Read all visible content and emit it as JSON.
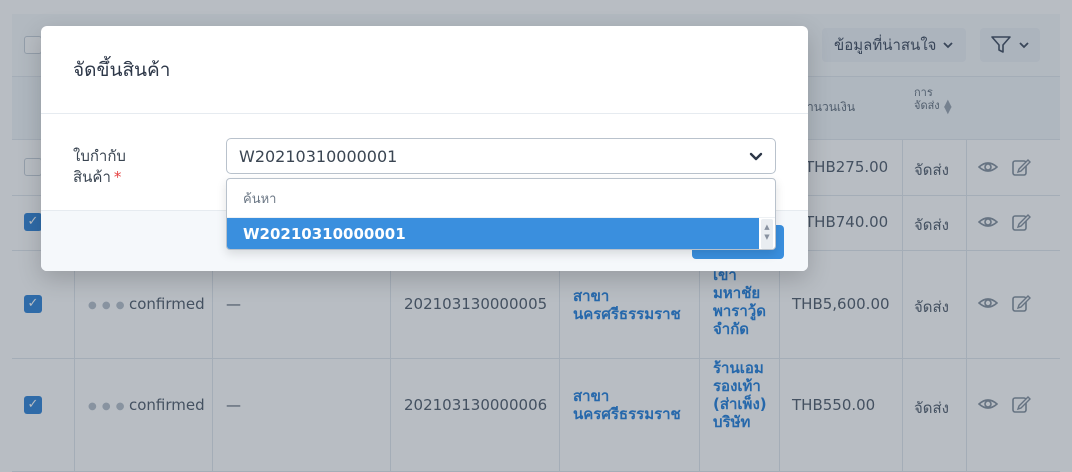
{
  "toolbar": {
    "info_label": "ข้อมูลที่น่าสนใจ",
    "filter_icon": "filter-icon",
    "chevron_icon": "chevron-down-icon"
  },
  "table": {
    "headers": {
      "amount": "จำนวนเงิน",
      "shipping": "การจัดส่ง"
    },
    "rows": [
      {
        "checked": false,
        "status": "",
        "dash": "",
        "number": "",
        "branch": "",
        "customer": "",
        "amount": "THB275.00",
        "shipping": "จัดส่ง"
      },
      {
        "checked": true,
        "status": "",
        "dash": "",
        "number": "",
        "branch": "",
        "customer": "",
        "amount": "THB740.00",
        "shipping": "จัดส่ง"
      },
      {
        "checked": true,
        "status": "confirmed",
        "dash": "—",
        "number": "202103130000005",
        "branch": "สาขานครศรีธรรมราช",
        "customer": "เขามหาชัยพาราวู้ด จำกัด",
        "amount": "THB5,600.00",
        "shipping": "จัดส่ง"
      },
      {
        "checked": true,
        "status": "confirmed",
        "dash": "—",
        "number": "202103130000006",
        "branch": "สาขานครศรีธรรมราช",
        "customer": "ร้านเอมรองเท้า (ส่าเพ็ง) บริษัท",
        "amount": "THB550.00",
        "shipping": "จัดส่ง"
      }
    ]
  },
  "modal": {
    "title": "จัดขึ้นสินค้า",
    "field_label_line1": "ใบกำกับ",
    "field_label_line2": "สินค้า",
    "required_mark": "*",
    "select_value": "W20210310000001"
  },
  "dropdown": {
    "search_placeholder": "ค้นหา",
    "options": [
      "W20210310000001"
    ],
    "selected_index": 0
  },
  "colors": {
    "accent": "#3a8fde",
    "link": "#2f86dd",
    "required": "#e53e3e"
  }
}
